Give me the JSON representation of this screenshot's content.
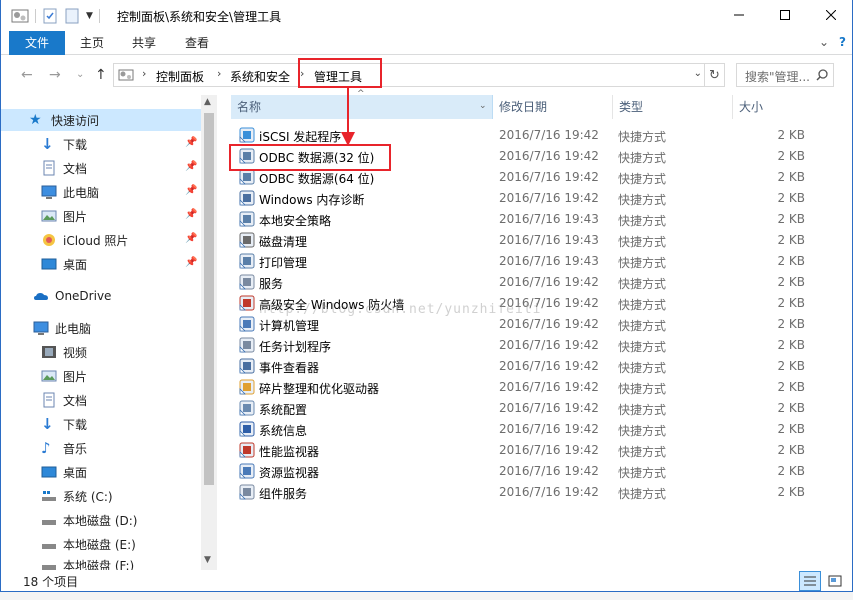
{
  "window": {
    "title": "控制面板\\系统和安全\\管理工具"
  },
  "ribbon": {
    "tabs": [
      "文件",
      "主页",
      "共享",
      "查看"
    ]
  },
  "address": {
    "crumbs": [
      "控制面板",
      "系统和安全",
      "管理工具"
    ],
    "search_placeholder": "搜索\"管理..."
  },
  "columns": {
    "name": "名称",
    "date": "修改日期",
    "type": "类型",
    "size": "大小"
  },
  "nav": {
    "quick_access": "快速访问",
    "quick_items": [
      "下载",
      "文档",
      "此电脑",
      "图片",
      "iCloud 照片",
      "桌面"
    ],
    "onedrive": "OneDrive",
    "this_pc": "此电脑",
    "pc_items": [
      "视频",
      "图片",
      "文档",
      "下载",
      "音乐",
      "桌面",
      "系统 (C:)",
      "本地磁盘 (D:)",
      "本地磁盘 (E:)",
      "本地磁盘 (F:)"
    ]
  },
  "files": [
    {
      "name": "iSCSI 发起程序",
      "date": "2016/7/16 19:42",
      "type": "快捷方式",
      "size": "2 KB"
    },
    {
      "name": "ODBC 数据源(32 位)",
      "date": "2016/7/16 19:42",
      "type": "快捷方式",
      "size": "2 KB"
    },
    {
      "name": "ODBC 数据源(64 位)",
      "date": "2016/7/16 19:42",
      "type": "快捷方式",
      "size": "2 KB"
    },
    {
      "name": "Windows 内存诊断",
      "date": "2016/7/16 19:42",
      "type": "快捷方式",
      "size": "2 KB"
    },
    {
      "name": "本地安全策略",
      "date": "2016/7/16 19:43",
      "type": "快捷方式",
      "size": "2 KB"
    },
    {
      "name": "磁盘清理",
      "date": "2016/7/16 19:43",
      "type": "快捷方式",
      "size": "2 KB"
    },
    {
      "name": "打印管理",
      "date": "2016/7/16 19:43",
      "type": "快捷方式",
      "size": "2 KB"
    },
    {
      "name": "服务",
      "date": "2016/7/16 19:42",
      "type": "快捷方式",
      "size": "2 KB"
    },
    {
      "name": "高级安全 Windows 防火墙",
      "date": "2016/7/16 19:42",
      "type": "快捷方式",
      "size": "2 KB"
    },
    {
      "name": "计算机管理",
      "date": "2016/7/16 19:42",
      "type": "快捷方式",
      "size": "2 KB"
    },
    {
      "name": "任务计划程序",
      "date": "2016/7/16 19:42",
      "type": "快捷方式",
      "size": "2 KB"
    },
    {
      "name": "事件查看器",
      "date": "2016/7/16 19:42",
      "type": "快捷方式",
      "size": "2 KB"
    },
    {
      "name": "碎片整理和优化驱动器",
      "date": "2016/7/16 19:42",
      "type": "快捷方式",
      "size": "2 KB"
    },
    {
      "name": "系统配置",
      "date": "2016/7/16 19:42",
      "type": "快捷方式",
      "size": "2 KB"
    },
    {
      "name": "系统信息",
      "date": "2016/7/16 19:42",
      "type": "快捷方式",
      "size": "2 KB"
    },
    {
      "name": "性能监视器",
      "date": "2016/7/16 19:42",
      "type": "快捷方式",
      "size": "2 KB"
    },
    {
      "name": "资源监视器",
      "date": "2016/7/16 19:42",
      "type": "快捷方式",
      "size": "2 KB"
    },
    {
      "name": "组件服务",
      "date": "2016/7/16 19:42",
      "type": "快捷方式",
      "size": "2 KB"
    }
  ],
  "status": {
    "count": "18 个项目"
  },
  "watermark": "http://blog.csdn.net/yunzhifeiti",
  "colors": {
    "accent": "#1979ca",
    "selection": "#cce8ff",
    "annotation_red": "#e8242b"
  }
}
